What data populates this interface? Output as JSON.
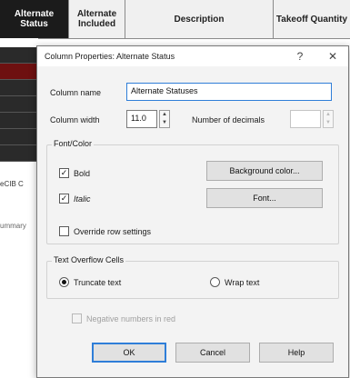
{
  "grid": {
    "columns": [
      {
        "label": "Alternate Status",
        "active": true
      },
      {
        "label": "Alternate Included",
        "active": false
      },
      {
        "label": "Description",
        "active": false
      },
      {
        "label": "Takeoff Quantity",
        "active": false
      }
    ],
    "left_cut_text": "eCIB C",
    "left_cut_text2": "ummary"
  },
  "dialog": {
    "title": "Column Properties: Alternate Status",
    "help_glyph": "?",
    "close_glyph": "✕",
    "column_name_label": "Column name",
    "column_name_value": "Alternate Statuses",
    "column_width_label": "Column width",
    "column_width_value": "11.0",
    "decimals_label": "Number of decimals",
    "decimals_value": "",
    "font_color_group": "Font/Color",
    "bold_label": "Bold",
    "italic_label": "Italic",
    "override_label": "Override row settings",
    "background_color_button": "Background color...",
    "font_button": "Font...",
    "overflow_group": "Text Overflow Cells",
    "truncate_label": "Truncate text",
    "wrap_label": "Wrap text",
    "negative_red_label": "Negative numbers in red",
    "ok_button": "OK",
    "cancel_button": "Cancel",
    "help_button": "Help",
    "bold_checked": true,
    "italic_checked": true,
    "override_checked": false,
    "negative_red_checked": false,
    "overflow_mode": "truncate"
  }
}
